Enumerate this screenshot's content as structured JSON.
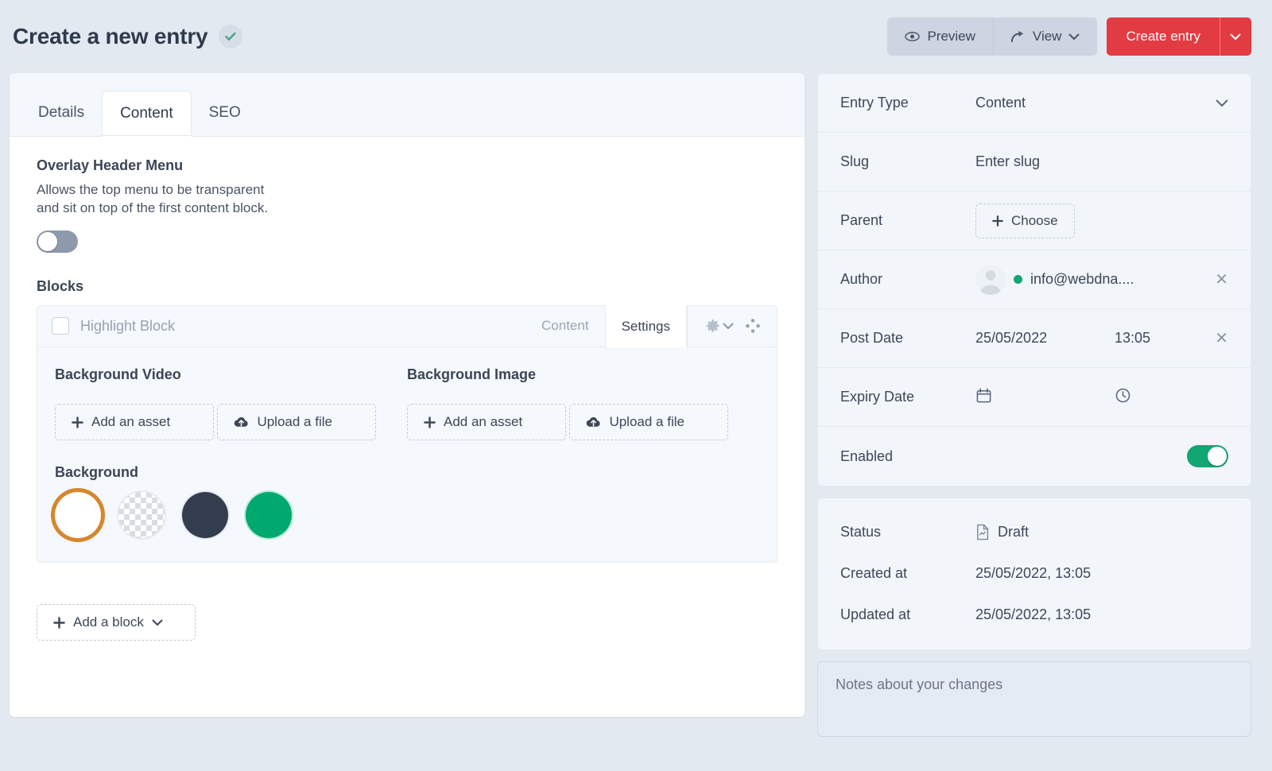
{
  "header": {
    "title": "Create a new entry",
    "saved_icon": "check-circle-icon",
    "preview_label": "Preview",
    "view_label": "View",
    "create_label": "Create entry",
    "create_accent_color": "#e33b42"
  },
  "tabs": [
    {
      "label": "Details",
      "active": false
    },
    {
      "label": "Content",
      "active": true
    },
    {
      "label": "SEO",
      "active": false
    }
  ],
  "content": {
    "overlay": {
      "title": "Overlay Header Menu",
      "description_line1": "Allows the top menu to be transparent",
      "description_line2": "and sit on top of the first content block.",
      "toggle_state": "off"
    },
    "blocks_title": "Blocks",
    "block": {
      "name": "Highlight Block",
      "checkbox_checked": false,
      "tab_content": "Content",
      "tab_settings": "Settings",
      "active_tab": "Settings",
      "background_video_title": "Background Video",
      "background_image_title": "Background Image",
      "add_asset_label": "Add an asset",
      "upload_file_label": "Upload a file",
      "background_title": "Background",
      "swatches": [
        {
          "name": "white",
          "color": "#ffffff",
          "selected": true
        },
        {
          "name": "transparent",
          "color": "transparent",
          "selected": false
        },
        {
          "name": "dark",
          "color": "#333d4e",
          "selected": false
        },
        {
          "name": "green",
          "color": "#00a870",
          "selected": false
        }
      ],
      "selected_swatch_ring": "#d6862c"
    },
    "add_block_label": "Add a block"
  },
  "sidebar": {
    "entry_type": {
      "label": "Entry Type",
      "value": "Content"
    },
    "slug": {
      "label": "Slug",
      "placeholder": "Enter slug"
    },
    "parent": {
      "label": "Parent",
      "choose_label": "Choose"
    },
    "author": {
      "label": "Author",
      "email": "info@webdna....",
      "online": true
    },
    "post_date": {
      "label": "Post Date",
      "date": "25/05/2022",
      "time": "13:05"
    },
    "expiry_date": {
      "label": "Expiry Date",
      "date": "",
      "time": ""
    },
    "enabled": {
      "label": "Enabled",
      "state": "on",
      "color": "#12a672"
    },
    "status": {
      "label": "Status",
      "value": "Draft"
    },
    "created_at": {
      "label": "Created at",
      "value": "25/05/2022, 13:05"
    },
    "updated_at": {
      "label": "Updated at",
      "value": "25/05/2022, 13:05"
    },
    "notes_placeholder": "Notes about your changes"
  }
}
